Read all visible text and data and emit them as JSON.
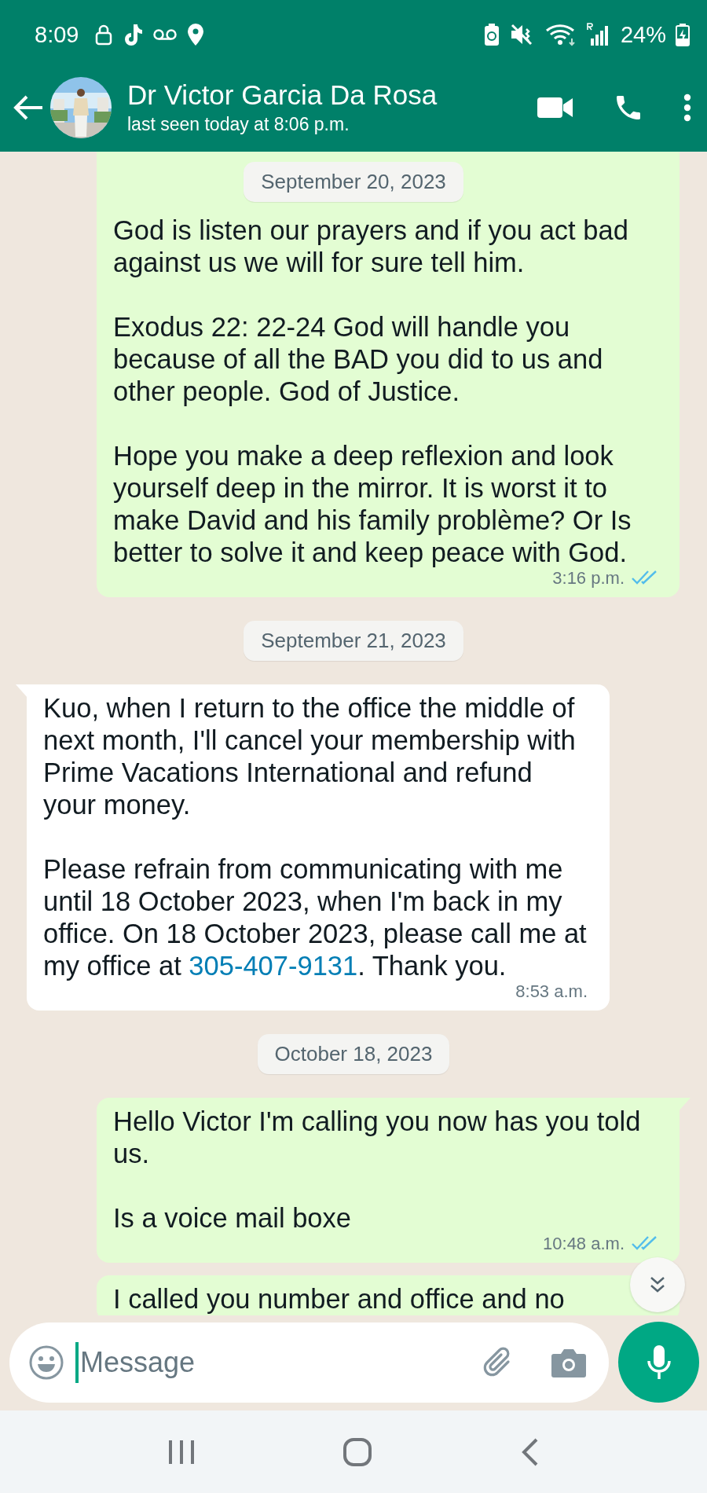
{
  "status_bar": {
    "time": "8:09",
    "battery": "24%"
  },
  "header": {
    "contact_name": "Dr Victor Garcia Da Rosa",
    "last_seen": "last seen today at 8:06 p.m."
  },
  "sticky_date": "September 20, 2023",
  "messages": [
    {
      "kind": "outgoing",
      "paragraphs": [
        {
          "text": "God is listen our prayers and if you act bad against us we will for sure tell him."
        },
        {
          "text": "Exodus 22: 22-24 God will handle you because of all the BAD you did to us and other people. God of Justice."
        },
        {
          "text": "Hope you make a deep reflexion and look yourself deep in the mirror. It is worst it to make David and his family problème? Or Is better to solve it and keep peace with God."
        }
      ],
      "time": "3:16 p.m.",
      "read": true
    },
    {
      "kind": "date",
      "label": "September 21, 2023"
    },
    {
      "kind": "incoming",
      "tail": true,
      "paragraphs": [
        {
          "text": "Kuo, when I return to the office the middle of next month, I'll cancel your membership with Prime Vacations International and refund your money."
        },
        {
          "text": "Please refrain from communicating with me until 18 October 2023, when I'm back in my office. On 18 October 2023, please call me at my office at ",
          "link": "305-407-9131",
          "after": ". Thank you."
        }
      ],
      "time": "8:53 a.m."
    },
    {
      "kind": "date",
      "label": "October 18, 2023"
    },
    {
      "kind": "outgoing",
      "tail": true,
      "paragraphs": [
        {
          "text": "Hello Victor I'm calling you now has you told us."
        },
        {
          "text": "Is a voice mail boxe"
        }
      ],
      "time": "10:48 a.m.",
      "read": true
    },
    {
      "kind": "outgoing",
      "paragraphs": [
        {
          "text": "I called you number and office and no"
        }
      ]
    }
  ],
  "composer": {
    "placeholder": "Message"
  }
}
